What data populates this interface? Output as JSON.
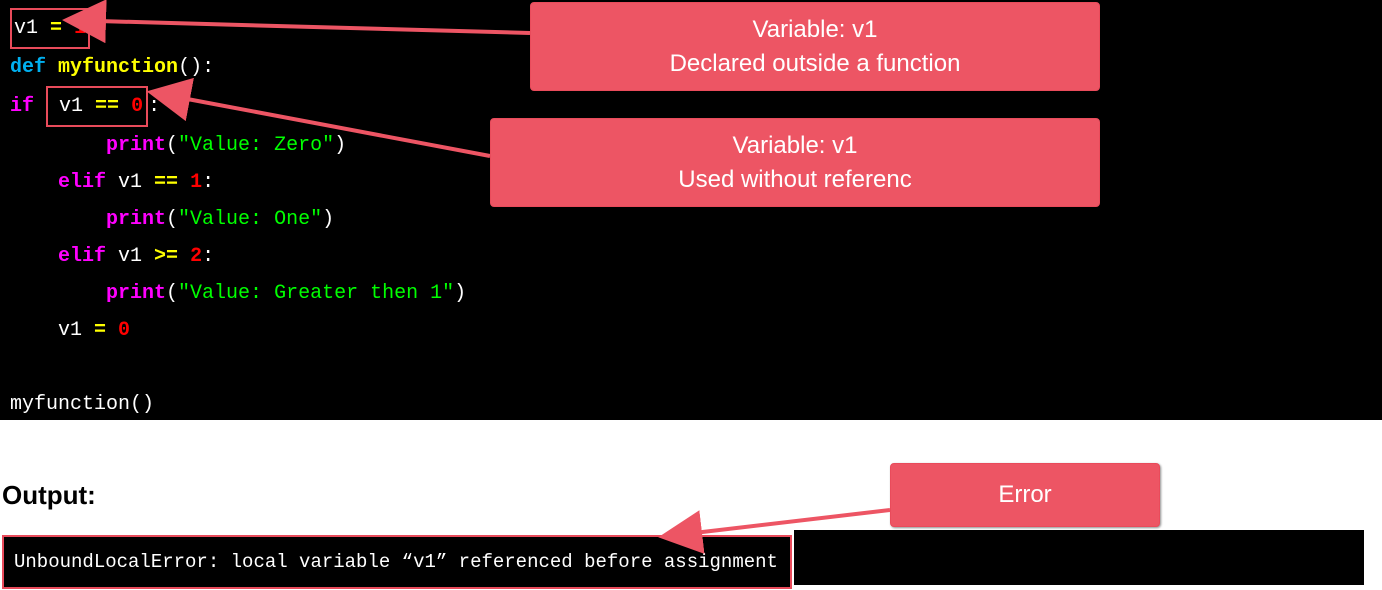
{
  "code": {
    "l1a": "v1 ",
    "l1b": "=",
    "l1c": " 1",
    "l2_def": "def",
    "l2_fn": "myfunction",
    "l2_end": "():",
    "l3_if": "if",
    "l3_var": " v1 ",
    "l3_eq": "==",
    "l3_num": " 0",
    "l3_colon": ":",
    "l4_print": "print",
    "l4_paren_o": "(",
    "l4_str": "\"Value: Zero\"",
    "l4_paren_c": ")",
    "l5_elif": "elif",
    "l5_var": " v1 ",
    "l5_eq": "==",
    "l5_num": " 1",
    "l5_colon": ":",
    "l6_str": "\"Value: One\"",
    "l7_elif": "elif",
    "l7_var": " v1 ",
    "l7_op": ">=",
    "l7_num": " 2",
    "l7_colon": ":",
    "l8_str": "\"Value: Greater then 1\"",
    "l9_var": "    v1 ",
    "l9_eq": "=",
    "l9_num": " 0",
    "l10": "myfunction()"
  },
  "callouts": {
    "c1_l1": "Variable: v1",
    "c1_l2": "Declared outside a function",
    "c2_l1": "Variable: v1",
    "c2_l2": "Used without referenc",
    "c3": "Error"
  },
  "output": {
    "label": "Output:",
    "text": "UnboundLocalError: local variable “v1” referenced before assignment"
  }
}
